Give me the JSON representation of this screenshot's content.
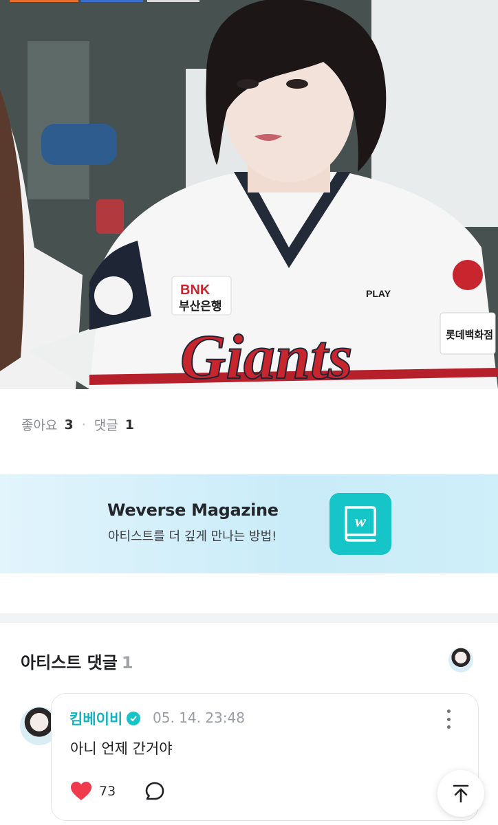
{
  "post": {
    "stats": {
      "likes_label": "좋아요",
      "likes_count": "3",
      "separator": "·",
      "comments_label": "댓글",
      "comments_count": "1"
    }
  },
  "photo": {
    "jersey_logo_text": "Giants",
    "sponsor_brand": "BNK",
    "sponsor_name": "부산은행",
    "sleeve_brand": "PLAY",
    "sleeve_sponsor": "롯데백화점"
  },
  "banner": {
    "title": "Weverse Magazine",
    "subtitle": "아티스트를 더 깊게 만나는 방법!",
    "icon_letter": "w"
  },
  "artist_comments": {
    "title": "아티스트 댓글",
    "count": "1",
    "comment": {
      "author": "킴베이비",
      "timestamp": "05. 14. 23:48",
      "text": "아니 언제 간거야",
      "like_count": "73"
    }
  },
  "icons": [
    "heart-icon",
    "reply-icon",
    "kebab-menu-icon",
    "verified-badge-icon",
    "scroll-to-top-icon",
    "magazine-icon"
  ],
  "colors": {
    "accent": "#16c5c7",
    "author": "#0fb6c2",
    "heart": "#ef3b4b",
    "banner_bg": "#d3effa",
    "muted_text": "#8b8e93"
  }
}
